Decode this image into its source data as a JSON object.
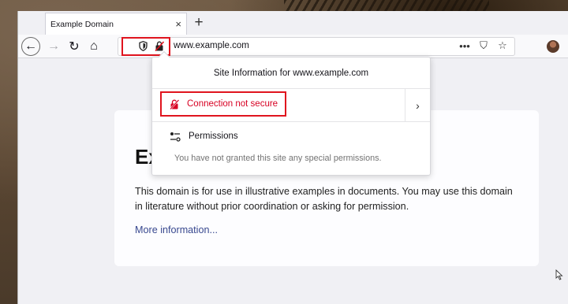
{
  "tab": {
    "title": "Example Domain",
    "close": "×",
    "new_tab": "+"
  },
  "nav": {
    "back": "←",
    "forward": "→",
    "reload": "↻",
    "home": "⌂"
  },
  "url": {
    "text": "www.example.com",
    "more": "•••",
    "pocket": "⛉",
    "bookmark": "☆"
  },
  "page": {
    "heading": "Ex",
    "paragraph": "This domain is for use in illustrative examples in documents. You may use this domain in literature without prior coordination or asking for permission.",
    "link": "More information..."
  },
  "popup": {
    "title": "Site Information for www.example.com",
    "connection": "Connection not secure",
    "connection_arrow": "›",
    "permissions_title": "Permissions",
    "permissions_desc": "You have not granted this site any special permissions."
  },
  "colors": {
    "insecure": "#d70022",
    "highlight": "#e0141e",
    "link": "#38488f"
  }
}
